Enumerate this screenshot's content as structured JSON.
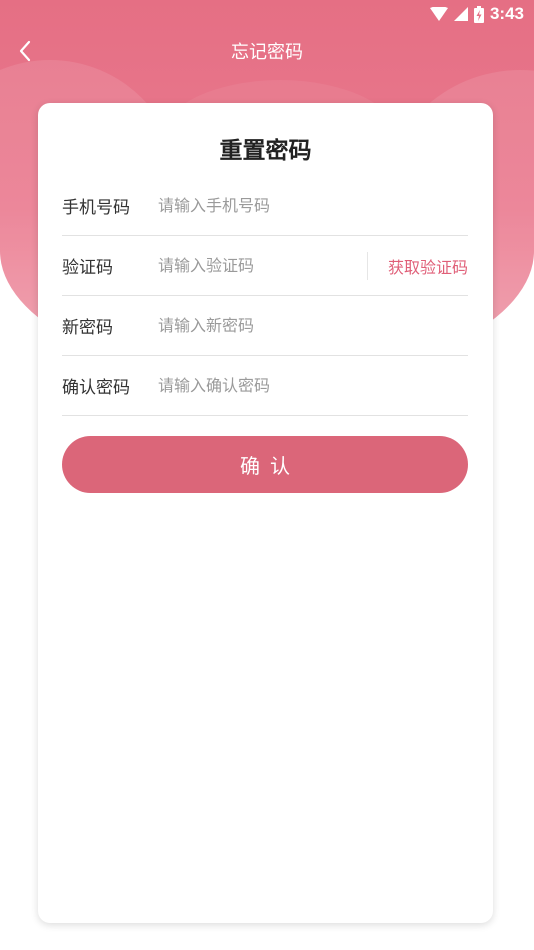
{
  "status_bar": {
    "time": "3:43",
    "icons": [
      "wifi-icon",
      "cellular-signal-icon",
      "battery-charging-icon"
    ]
  },
  "nav": {
    "back_icon": "chevron-left-icon",
    "title": "忘记密码"
  },
  "form": {
    "title": "重置密码",
    "phone": {
      "label": "手机号码",
      "value": "",
      "placeholder": "请输入手机号码"
    },
    "code": {
      "label": "验证码",
      "value": "",
      "placeholder": "请输入验证码",
      "get_code_label": "获取验证码"
    },
    "new_password": {
      "label": "新密码",
      "value": "",
      "placeholder": "请输入新密码"
    },
    "confirm_password": {
      "label": "确认密码",
      "value": "",
      "placeholder": "请输入确认密码"
    },
    "submit_label": "确认"
  },
  "colors": {
    "header_bg": "#e56f84",
    "accent_text": "#e05f78",
    "button_bg": "#db6679",
    "card_bg": "#ffffff"
  }
}
